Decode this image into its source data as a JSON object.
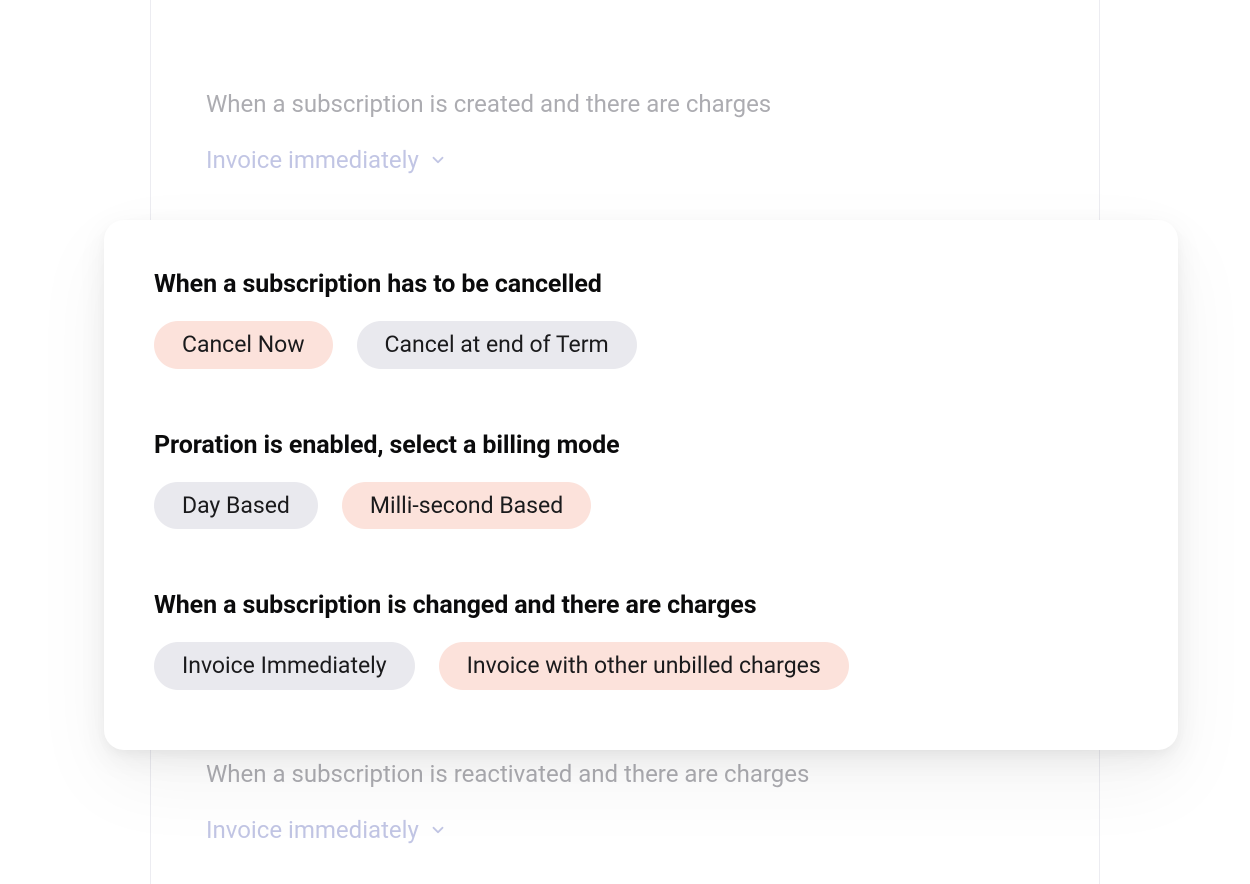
{
  "bg": {
    "top": {
      "label": "When a subscription is created and there are charges",
      "dropdown_label": "Invoice immediately"
    },
    "bottom": {
      "label": "When a subscription is reactivated and there are charges",
      "dropdown_label": "Invoice immediately"
    }
  },
  "card": {
    "sections": [
      {
        "heading": "When a subscription has to be cancelled",
        "options": [
          {
            "label": "Cancel Now",
            "selected": true
          },
          {
            "label": "Cancel at end of Term",
            "selected": false
          }
        ]
      },
      {
        "heading": "Proration is enabled, select a billing mode",
        "options": [
          {
            "label": "Day Based",
            "selected": false
          },
          {
            "label": "Milli-second Based",
            "selected": true
          }
        ]
      },
      {
        "heading": "When a subscription is changed and there are charges",
        "options": [
          {
            "label": "Invoice Immediately",
            "selected": false
          },
          {
            "label": "Invoice with other unbilled charges",
            "selected": true
          }
        ]
      }
    ]
  }
}
